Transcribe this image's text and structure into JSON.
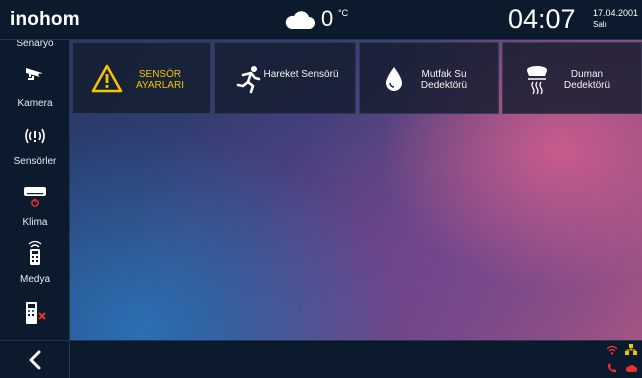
{
  "header": {
    "brand": "inohom",
    "weather_icon": "cloud-icon",
    "temperature": "0",
    "temperature_unit": "°C",
    "time": "04:07",
    "date": "17.04.2001",
    "day": "Salı"
  },
  "sidebar": {
    "items": [
      {
        "label": "Senaryo",
        "icon": "scenario-icon"
      },
      {
        "label": "Kamera",
        "icon": "camera-icon"
      },
      {
        "label": "Sensörler",
        "icon": "sensor-icon"
      },
      {
        "label": "Klima",
        "icon": "air-conditioner-icon"
      },
      {
        "label": "Medya",
        "icon": "remote-control-icon"
      },
      {
        "label": "",
        "icon": "intercom-icon"
      }
    ]
  },
  "sensors": [
    {
      "label": "SENSÖR AYARLARI",
      "icon": "warning-icon",
      "color": "#f5c400"
    },
    {
      "label": "Hareket Sensörü",
      "icon": "motion-icon"
    },
    {
      "label": "Mutfak Su Dedektörü",
      "icon": "water-drop-icon"
    },
    {
      "label": "Duman Dedektörü",
      "icon": "smoke-detector-icon"
    }
  ],
  "footer": {
    "back_icon": "chevron-left-icon",
    "status_icons": [
      "wifi-icon",
      "network-icon",
      "phone-icon",
      "cloud-alert-icon"
    ]
  },
  "colors": {
    "bar_background": "#0c1a2d",
    "alert_yellow": "#f5c400",
    "warning_red": "#e8322e"
  }
}
